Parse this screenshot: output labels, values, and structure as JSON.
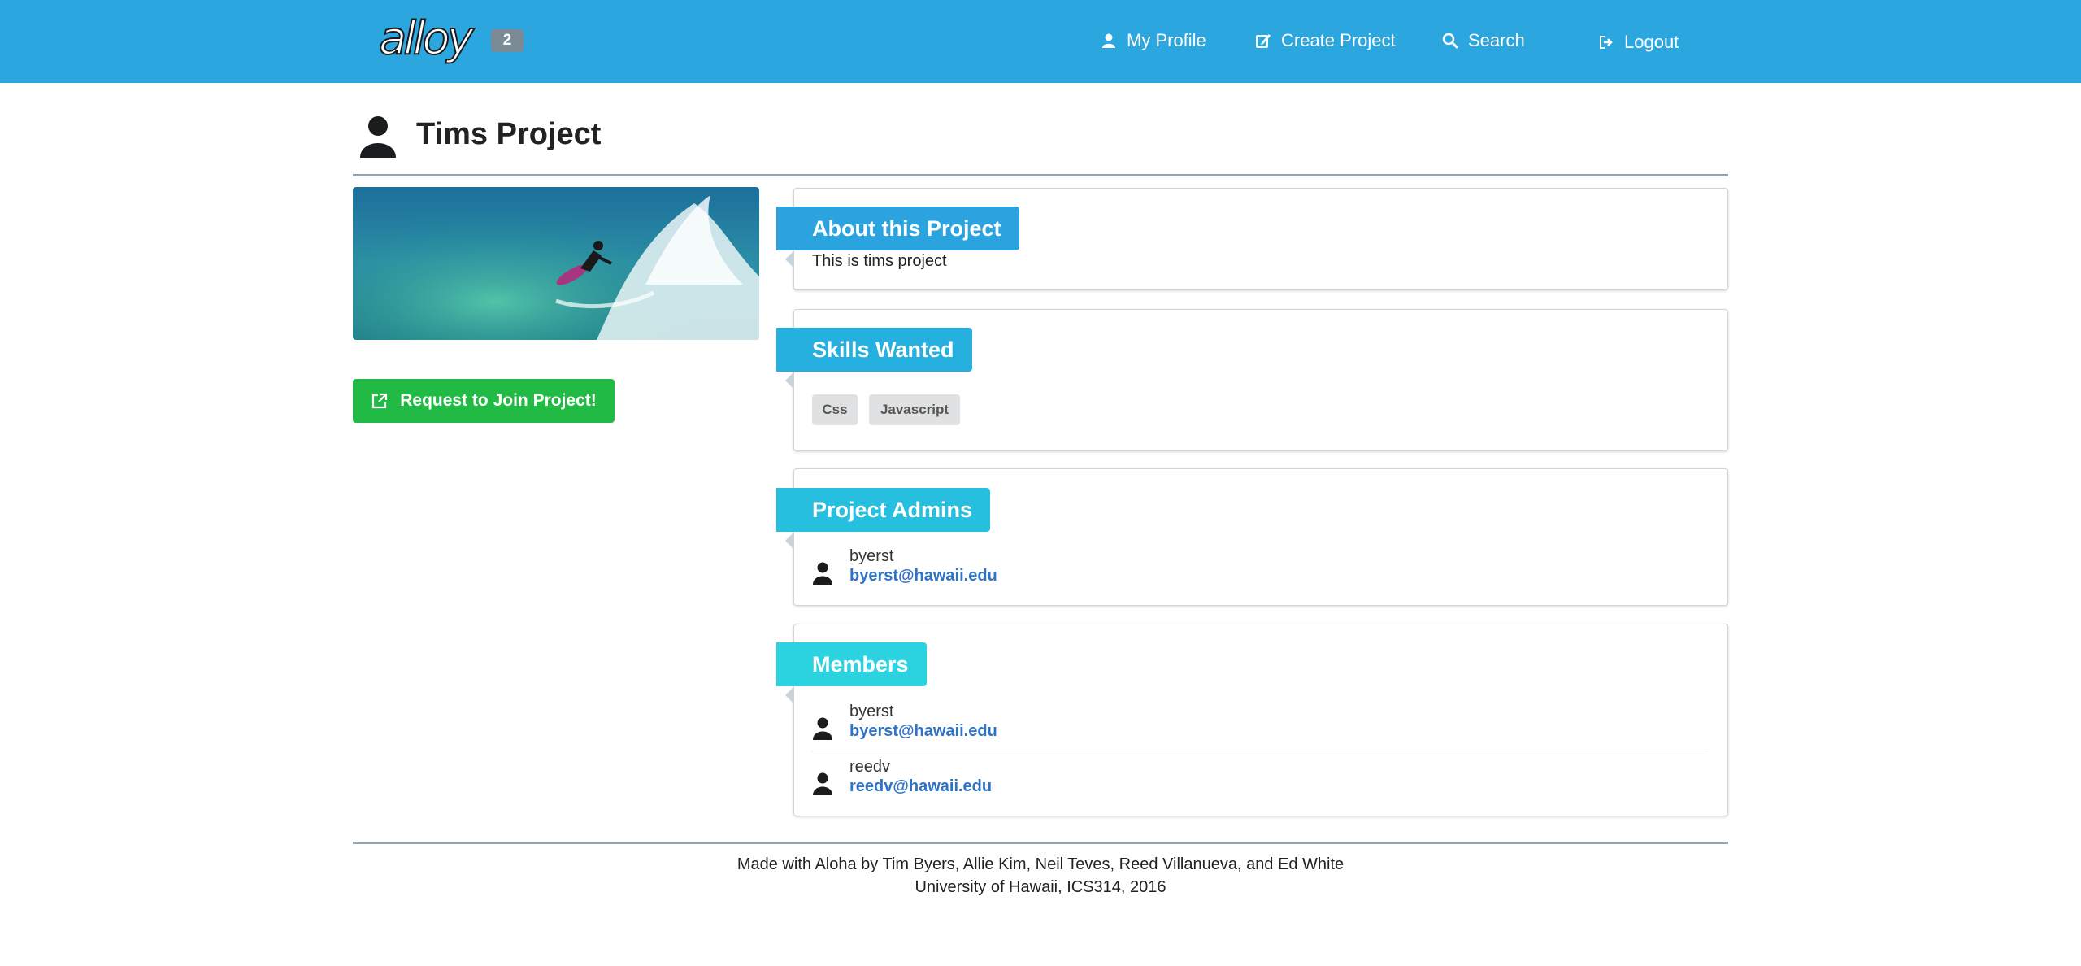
{
  "nav": {
    "logo_text": "alloy",
    "badge": "2",
    "items": [
      {
        "label": "My Profile",
        "icon": "user-icon"
      },
      {
        "label": "Create Project",
        "icon": "edit-icon"
      },
      {
        "label": "Search",
        "icon": "search-icon"
      },
      {
        "label": "Logout",
        "icon": "sign-out-icon"
      }
    ]
  },
  "page": {
    "title": "Tims Project",
    "title_icon": "user-icon",
    "image": "surfer-photo",
    "join_button": "Request to Join Project!",
    "join_icon": "external-link-icon"
  },
  "sections": {
    "about": {
      "heading": "About this Project",
      "text": "This is tims project",
      "color": "#2aa3de"
    },
    "skills": {
      "heading": "Skills Wanted",
      "items": [
        "Css",
        "Javascript"
      ],
      "color": "#25b0df"
    },
    "admins": {
      "heading": "Project Admins",
      "color": "#26bfe0",
      "people": [
        {
          "name": "byerst",
          "email": "byerst@hawaii.edu"
        }
      ]
    },
    "members": {
      "heading": "Members",
      "color": "#2bd2e0",
      "people": [
        {
          "name": "byerst",
          "email": "byerst@hawaii.edu"
        },
        {
          "name": "reedv",
          "email": "reedv@hawaii.edu"
        }
      ]
    }
  },
  "footer": {
    "line1": "Made with Aloha by Tim Byers, Allie Kim, Neil Teves, Reed Villanueva, and Ed White",
    "line2": "University of Hawaii, ICS314, 2016"
  },
  "colors": {
    "nav_bg": "#2ba6de",
    "join_button": "#21ba45",
    "link": "#2f73c4"
  }
}
